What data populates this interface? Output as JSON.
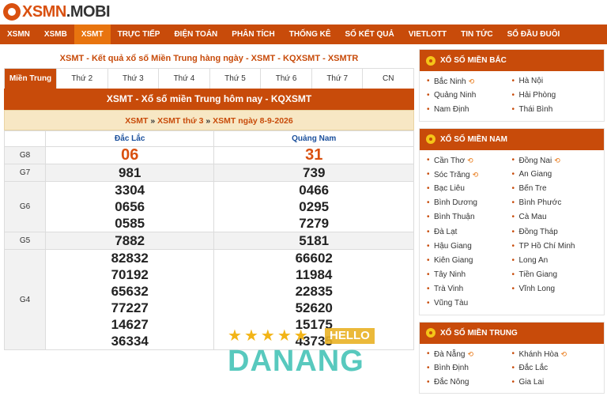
{
  "site": {
    "logo_main": "XSMN",
    "logo_dot": ".MOBI"
  },
  "nav": [
    "XSMN",
    "XSMB",
    "XSMT",
    "TRỰC TIẾP",
    "ĐIỆN TOÁN",
    "PHÂN TÍCH",
    "THỐNG KÊ",
    "SỐ KẾT QUẢ",
    "VIETLOTT",
    "TIN TỨC",
    "SỔ ĐẦU ĐUÔI"
  ],
  "nav_active": "XSMT",
  "main": {
    "title": "XSMT - Kết quả xổ số Miền Trung hàng ngày - XSMT - KQXSMT - XSMTR",
    "tabs": [
      "Miền Trung",
      "Thứ 2",
      "Thứ 3",
      "Thứ 4",
      "Thứ 5",
      "Thứ 6",
      "Thứ 7",
      "CN"
    ],
    "box_title": "XSMT - Xổ số miền Trung hôm nay - KQXSMT",
    "breadcrumb": {
      "a": "XSMT",
      "sep": " » ",
      "b": "XSMT thứ 3",
      "c": "XSMT ngày 8-9-2026"
    },
    "columns": [
      "Đắc Lắc",
      "Quảng Nam"
    ],
    "rows": [
      {
        "prize": "G8",
        "a": [
          "06"
        ],
        "b": [
          "31"
        ]
      },
      {
        "prize": "G7",
        "a": [
          "981"
        ],
        "b": [
          "739"
        ]
      },
      {
        "prize": "G6",
        "a": [
          "3304",
          "0656",
          "0585"
        ],
        "b": [
          "0466",
          "0295",
          "7279"
        ]
      },
      {
        "prize": "G5",
        "a": [
          "7882"
        ],
        "b": [
          "5181"
        ]
      },
      {
        "prize": "G4",
        "a": [
          "82832",
          "70192",
          "65632",
          "77227",
          "14627",
          "36334"
        ],
        "b": [
          "66602",
          "11984",
          "22835",
          "52620",
          "15175",
          "43735"
        ]
      }
    ]
  },
  "sidebar": [
    {
      "title": "XỔ SỐ MIỀN BẮC",
      "items": [
        {
          "name": "Bắc Ninh",
          "live": true
        },
        {
          "name": "Hà Nội"
        },
        {
          "name": "Quảng Ninh"
        },
        {
          "name": "Hải Phòng"
        },
        {
          "name": "Nam Định"
        },
        {
          "name": "Thái Bình"
        }
      ]
    },
    {
      "title": "XỔ SỐ MIỀN NAM",
      "items": [
        {
          "name": "Cần Thơ",
          "live": true
        },
        {
          "name": "Đồng Nai",
          "live": true
        },
        {
          "name": "Sóc Trăng",
          "live": true
        },
        {
          "name": "An Giang"
        },
        {
          "name": "Bạc Liêu"
        },
        {
          "name": "Bến Tre"
        },
        {
          "name": "Bình Dương"
        },
        {
          "name": "Bình Phước"
        },
        {
          "name": "Bình Thuận"
        },
        {
          "name": "Cà Mau"
        },
        {
          "name": "Đà Lạt"
        },
        {
          "name": "Đồng Tháp"
        },
        {
          "name": "Hậu Giang"
        },
        {
          "name": "TP Hồ Chí Minh"
        },
        {
          "name": "Kiên Giang"
        },
        {
          "name": "Long An"
        },
        {
          "name": "Tây Ninh"
        },
        {
          "name": "Tiền Giang"
        },
        {
          "name": "Trà Vinh"
        },
        {
          "name": "Vĩnh Long"
        },
        {
          "name": "Vũng Tàu"
        }
      ]
    },
    {
      "title": "XỔ SỐ MIỀN TRUNG",
      "items": [
        {
          "name": "Đà Nẵng",
          "live": true
        },
        {
          "name": "Khánh Hòa",
          "live": true
        },
        {
          "name": "Bình Định"
        },
        {
          "name": "Đắc Lắc"
        },
        {
          "name": "Đắc Nông"
        },
        {
          "name": "Gia Lai"
        }
      ]
    }
  ],
  "watermark": {
    "hello": "HELLO",
    "text": "DANANG"
  },
  "colors": {
    "brand": "#c84b0a",
    "accent": "#e8740f",
    "special": "#d9500f"
  }
}
